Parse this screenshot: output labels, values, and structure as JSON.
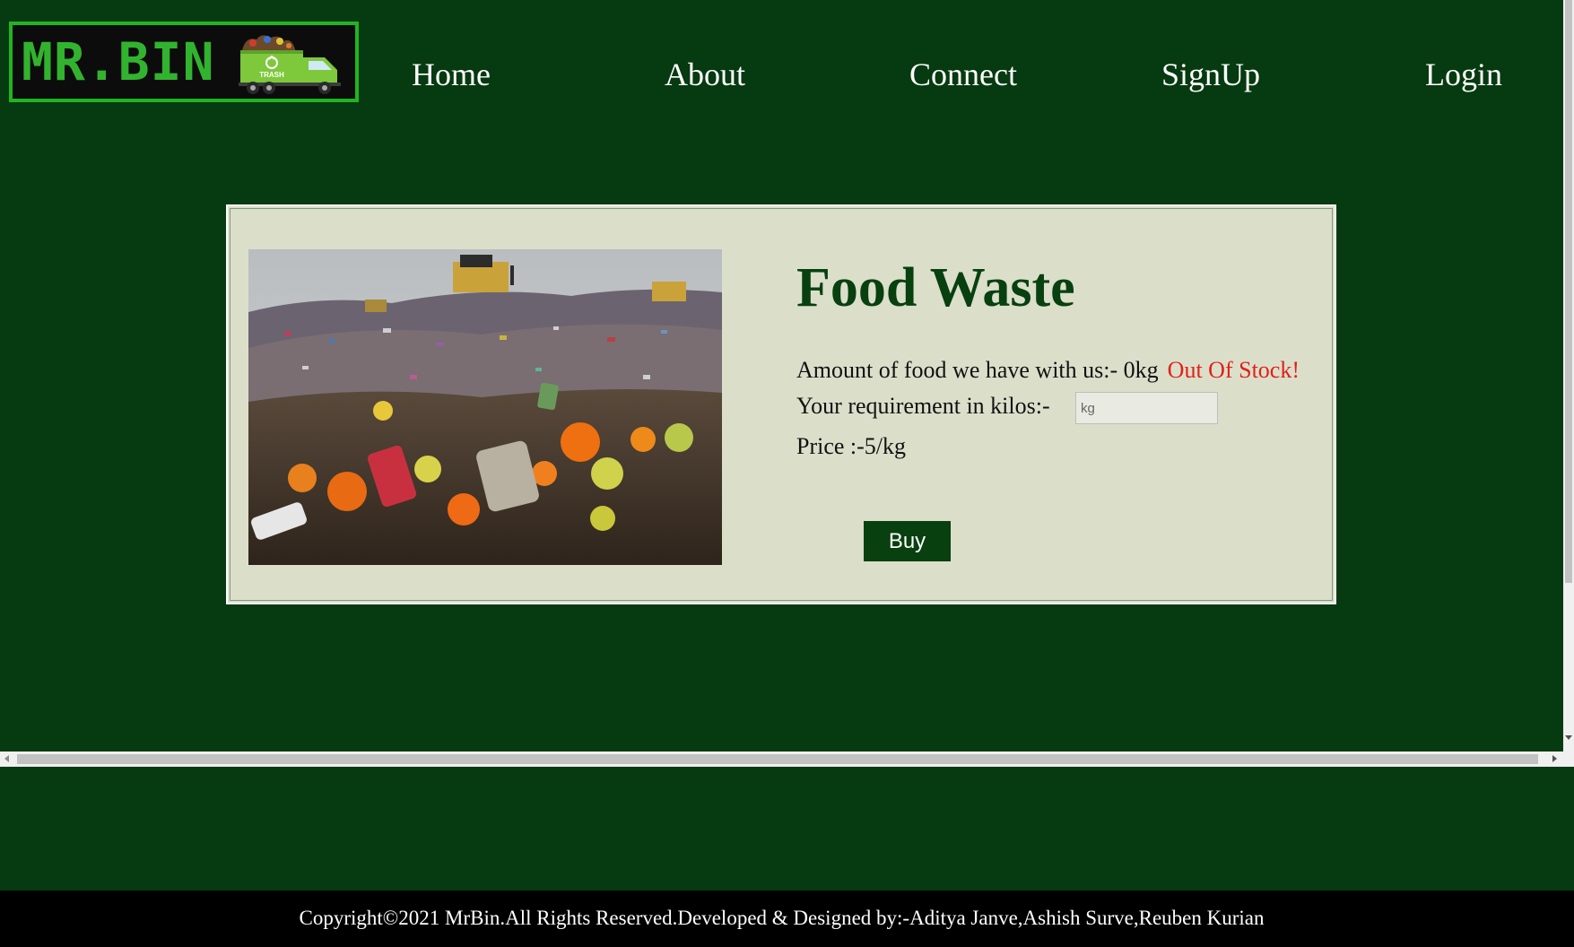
{
  "header": {
    "logo_text": "MR.BIN",
    "truck_label": "TRASH",
    "nav": {
      "home": "Home",
      "about": "About",
      "connect": "Connect",
      "signup": "SignUp",
      "login": "Login"
    }
  },
  "product": {
    "title": "Food Waste",
    "stock_text": "Amount of food we have with us:- 0kg",
    "stock_status": "Out Of Stock!",
    "requirement_label": "Your requirement in kilos:-",
    "requirement_placeholder": "kg",
    "price_text": "Price :-5/kg",
    "buy_label": "Buy"
  },
  "footer": {
    "copyright": "Copyright©2021 MrBin.All Rights Reserved.Developed & Designed by:-Aditya Janve,Ashish Surve,Reuben Kurian"
  },
  "colors": {
    "page_background": "#063a10",
    "card_background": "#dbdfca",
    "accent_green": "#08400f",
    "logo_green": "#32b32f",
    "out_of_stock_red": "#e0211a",
    "footer_background": "#000000"
  },
  "icons": {
    "logo_truck": "garbage-truck-icon",
    "recycle": "recycle-icon"
  }
}
